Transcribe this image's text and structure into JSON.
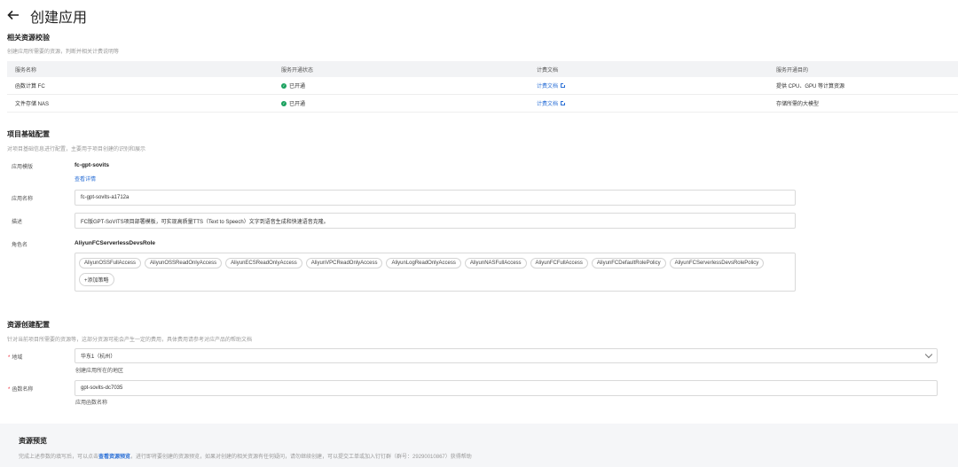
{
  "header": {
    "title": "创建应用"
  },
  "resource_check": {
    "title": "相关资源校验",
    "desc": "创建应用所需要的资源，判断并相关计费说明等",
    "columns": [
      "服务名称",
      "服务开通状态",
      "计费文档",
      "服务开通目的"
    ],
    "rows": [
      {
        "name": "函数计算 FC",
        "status": "已开通",
        "doc": "计费文档",
        "purpose": "提供 CPU、GPU 等计算资源"
      },
      {
        "name": "文件存储 NAS",
        "status": "已开通",
        "doc": "计费文档",
        "purpose": "存储所需的大模型"
      }
    ]
  },
  "basic_config": {
    "title": "项目基础配置",
    "desc": "对项目基础信息进行配置，主要用于项目创建的识别和展示",
    "template_label": "应用模版",
    "template_value": "fc-gpt-sovits",
    "template_link": "查看详情",
    "app_name_label": "应用名称",
    "app_name_value": "fc-gpt-sovits-a1712a",
    "desc_label": "描述",
    "desc_value": "FC版GPT-SoVITS项目部署模板，可实现高质量TTS（Text to Speech）文字到语音生成和快速语音克隆。",
    "role_label": "角色名",
    "role_value": "AliyunFCServerlessDevsRole",
    "policies": [
      "AliyunOSSFullAccess",
      "AliyunOSSReadOnlyAccess",
      "AliyunECSReadOnlyAccess",
      "AliyunVPCReadOnlyAccess",
      "AliyunLogReadOnlyAccess",
      "AliyunNASFullAccess",
      "AliyunFCFullAccess",
      "AliyunFCDefaultRolePolicy",
      "AliyunFCServerlessDevsRolePolicy"
    ],
    "add_policy": "+添加策略"
  },
  "resource_config": {
    "title": "资源创建配置",
    "desc": "针对当前项目所需要的资源等，这部分资源可能会产生一定的费用，具体费用请参考对应产品的帮助文档",
    "region_label": "地域",
    "region_value": "华东1（杭州）",
    "region_hint": "创建应用所在的地区",
    "func_label": "函数名称",
    "func_value": "gpt-sovits-dc7035",
    "func_hint": "应用函数名称"
  },
  "preview": {
    "title": "资源预览",
    "desc_before": "完成上述参数的填写后，可以点击",
    "desc_link": "查看资源预览",
    "desc_after": "，进行即将要创建的资源预览，如果对创建的相关资源有任何疑问，请勿继续创建，可以提交工单或加入钉钉群（群号：29290010867）获得帮助"
  }
}
